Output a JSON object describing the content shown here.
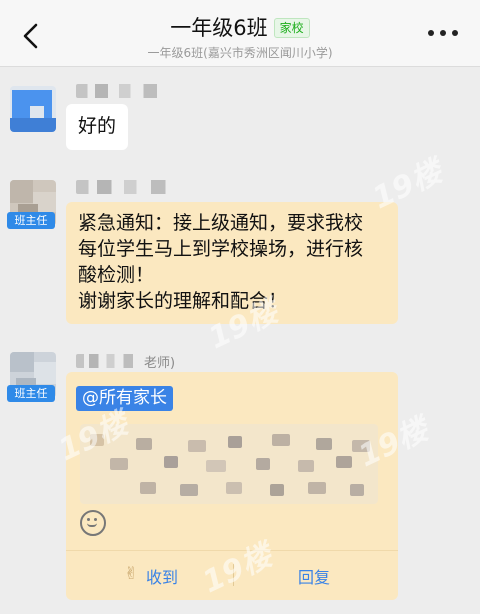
{
  "header": {
    "back_icon": "chevron-left-icon",
    "title": "一年级6班",
    "badge": "家校",
    "subtitle": "一年级6班(嘉兴市秀洲区闻川小学)",
    "more_icon": "more-dots-icon"
  },
  "messages": [
    {
      "sender_role": "",
      "text": "好的"
    },
    {
      "sender_role": "班主任",
      "text_lines": [
        "紧急通知：接上级通知，要求我校",
        "每位学生马上到学校操场，进行核",
        "酸检测！",
        "谢谢家长的理解和配合！"
      ]
    },
    {
      "sender_role": "班主任",
      "sender_suffix": "老师)",
      "mention": "@所有家长",
      "actions": {
        "received": "收到",
        "reply": "回复"
      }
    }
  ],
  "colors": {
    "accent": "#3a83e6",
    "tag": "#2f8ae8",
    "notice_bg": "#fbe8c0",
    "badge_green": "#1aad19"
  },
  "watermark": "19楼"
}
